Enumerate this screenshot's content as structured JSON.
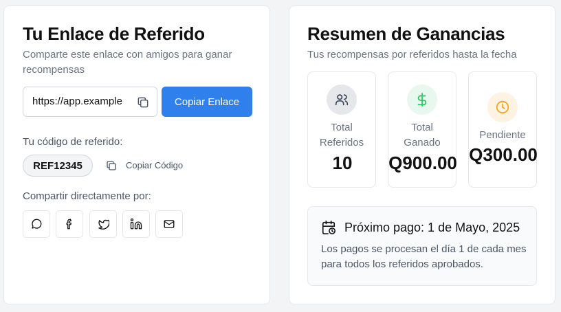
{
  "referral": {
    "title": "Tu Enlace de Referido",
    "subtitle": "Comparte este enlace con amigos para ganar recompensas",
    "link_value": "https://app.example",
    "copy_link_label": "Copiar Enlace",
    "code_label": "Tu código de referido:",
    "code_value": "REF12345",
    "copy_code_label": "Copiar Código",
    "share_label": "Compartir directamente por:",
    "share_icons": [
      "whatsapp-icon",
      "facebook-icon",
      "twitter-icon",
      "linkedin-icon",
      "mail-icon"
    ],
    "accent_color": "#2f80ed"
  },
  "earnings": {
    "title": "Resumen de Ganancias",
    "subtitle": "Tus recompensas por referidos hasta la fecha",
    "stats": [
      {
        "label_line1": "Total",
        "label_line2": "Referidos",
        "value": "10",
        "icon": "users-icon",
        "icon_color": "#374151",
        "icon_bg": "#e5e7eb"
      },
      {
        "label_line1": "Total",
        "label_line2": "Ganado",
        "value": "Q900.00",
        "icon": "dollar-icon",
        "icon_color": "#22c55e",
        "icon_bg": "#e8f8ee"
      },
      {
        "label_line1": "Pendiente",
        "label_line2": "",
        "value": "Q300.00",
        "icon": "clock-icon",
        "icon_color": "#f59e0b",
        "icon_bg": "#fef3e2"
      }
    ],
    "payout": {
      "title": "Próximo pago: 1 de Mayo, 2025",
      "description": "Los pagos se procesan el día 1 de cada mes para todos los referidos aprobados.",
      "icon": "calendar-clock-icon"
    }
  }
}
